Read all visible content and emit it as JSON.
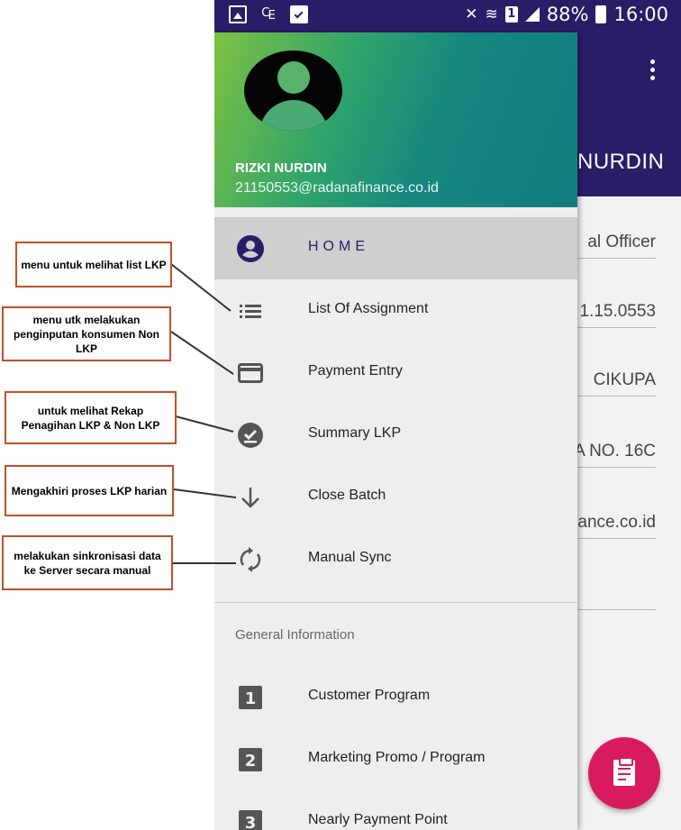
{
  "status_bar": {
    "battery": "88%",
    "time": "16:00"
  },
  "background_app": {
    "title_fragment": "NURDIN",
    "fields": [
      "al Officer",
      "1.15.0553",
      "CIKUPA",
      "A NO. 16C",
      "ance.co.id",
      ""
    ]
  },
  "drawer": {
    "user_name": "RIZKI NURDIN",
    "user_email": "21150553@radanafinance.co.id",
    "menu_items": [
      {
        "label": "HOME",
        "icon": "account-circle-icon",
        "active": true
      },
      {
        "label": "List Of Assignment",
        "icon": "list-icon",
        "active": false
      },
      {
        "label": "Payment Entry",
        "icon": "credit-card-icon",
        "active": false
      },
      {
        "label": "Summary LKP",
        "icon": "check-circle-icon",
        "active": false
      },
      {
        "label": "Close Batch",
        "icon": "arrow-down-icon",
        "active": false
      },
      {
        "label": "Manual Sync",
        "icon": "sync-icon",
        "active": false
      }
    ],
    "section_title": "General Information",
    "info_items": [
      {
        "label": "Customer Program",
        "badge": "1"
      },
      {
        "label": "Marketing Promo / Program",
        "badge": "2"
      },
      {
        "label": "Nearly Payment Point",
        "badge": "3"
      }
    ]
  },
  "annotations": [
    "menu untuk melihat list LKP",
    "menu utk melakukan penginputan konsumen Non LKP",
    "untuk melihat Rekap Penagihan LKP & Non LKP",
    "Mengakhiri proses LKP harian",
    "melakukan sinkronisasi data ke Server secara manual"
  ],
  "colors": {
    "status_bar": "#2a1d67",
    "accent": "#2a1d67",
    "fab": "#d81b60",
    "annotation_border": "#c0502a"
  }
}
